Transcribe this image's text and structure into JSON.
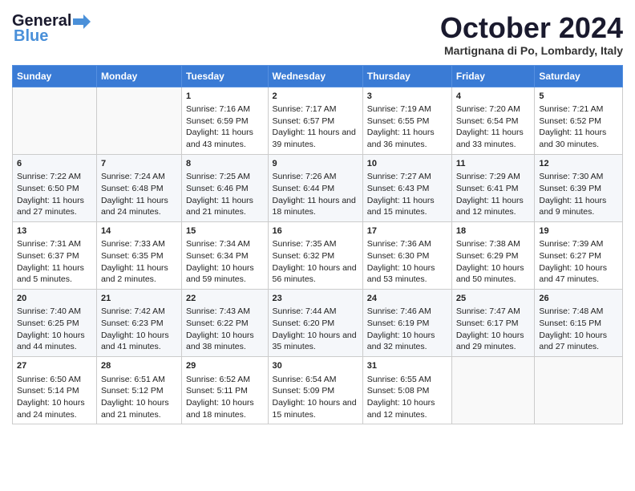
{
  "header": {
    "logo_general": "General",
    "logo_blue": "Blue",
    "title": "October 2024",
    "location": "Martignana di Po, Lombardy, Italy"
  },
  "days_of_week": [
    "Sunday",
    "Monday",
    "Tuesday",
    "Wednesday",
    "Thursday",
    "Friday",
    "Saturday"
  ],
  "weeks": [
    [
      {
        "day": "",
        "content": ""
      },
      {
        "day": "",
        "content": ""
      },
      {
        "day": "1",
        "content": "Sunrise: 7:16 AM\nSunset: 6:59 PM\nDaylight: 11 hours and 43 minutes."
      },
      {
        "day": "2",
        "content": "Sunrise: 7:17 AM\nSunset: 6:57 PM\nDaylight: 11 hours and 39 minutes."
      },
      {
        "day": "3",
        "content": "Sunrise: 7:19 AM\nSunset: 6:55 PM\nDaylight: 11 hours and 36 minutes."
      },
      {
        "day": "4",
        "content": "Sunrise: 7:20 AM\nSunset: 6:54 PM\nDaylight: 11 hours and 33 minutes."
      },
      {
        "day": "5",
        "content": "Sunrise: 7:21 AM\nSunset: 6:52 PM\nDaylight: 11 hours and 30 minutes."
      }
    ],
    [
      {
        "day": "6",
        "content": "Sunrise: 7:22 AM\nSunset: 6:50 PM\nDaylight: 11 hours and 27 minutes."
      },
      {
        "day": "7",
        "content": "Sunrise: 7:24 AM\nSunset: 6:48 PM\nDaylight: 11 hours and 24 minutes."
      },
      {
        "day": "8",
        "content": "Sunrise: 7:25 AM\nSunset: 6:46 PM\nDaylight: 11 hours and 21 minutes."
      },
      {
        "day": "9",
        "content": "Sunrise: 7:26 AM\nSunset: 6:44 PM\nDaylight: 11 hours and 18 minutes."
      },
      {
        "day": "10",
        "content": "Sunrise: 7:27 AM\nSunset: 6:43 PM\nDaylight: 11 hours and 15 minutes."
      },
      {
        "day": "11",
        "content": "Sunrise: 7:29 AM\nSunset: 6:41 PM\nDaylight: 11 hours and 12 minutes."
      },
      {
        "day": "12",
        "content": "Sunrise: 7:30 AM\nSunset: 6:39 PM\nDaylight: 11 hours and 9 minutes."
      }
    ],
    [
      {
        "day": "13",
        "content": "Sunrise: 7:31 AM\nSunset: 6:37 PM\nDaylight: 11 hours and 5 minutes."
      },
      {
        "day": "14",
        "content": "Sunrise: 7:33 AM\nSunset: 6:35 PM\nDaylight: 11 hours and 2 minutes."
      },
      {
        "day": "15",
        "content": "Sunrise: 7:34 AM\nSunset: 6:34 PM\nDaylight: 10 hours and 59 minutes."
      },
      {
        "day": "16",
        "content": "Sunrise: 7:35 AM\nSunset: 6:32 PM\nDaylight: 10 hours and 56 minutes."
      },
      {
        "day": "17",
        "content": "Sunrise: 7:36 AM\nSunset: 6:30 PM\nDaylight: 10 hours and 53 minutes."
      },
      {
        "day": "18",
        "content": "Sunrise: 7:38 AM\nSunset: 6:29 PM\nDaylight: 10 hours and 50 minutes."
      },
      {
        "day": "19",
        "content": "Sunrise: 7:39 AM\nSunset: 6:27 PM\nDaylight: 10 hours and 47 minutes."
      }
    ],
    [
      {
        "day": "20",
        "content": "Sunrise: 7:40 AM\nSunset: 6:25 PM\nDaylight: 10 hours and 44 minutes."
      },
      {
        "day": "21",
        "content": "Sunrise: 7:42 AM\nSunset: 6:23 PM\nDaylight: 10 hours and 41 minutes."
      },
      {
        "day": "22",
        "content": "Sunrise: 7:43 AM\nSunset: 6:22 PM\nDaylight: 10 hours and 38 minutes."
      },
      {
        "day": "23",
        "content": "Sunrise: 7:44 AM\nSunset: 6:20 PM\nDaylight: 10 hours and 35 minutes."
      },
      {
        "day": "24",
        "content": "Sunrise: 7:46 AM\nSunset: 6:19 PM\nDaylight: 10 hours and 32 minutes."
      },
      {
        "day": "25",
        "content": "Sunrise: 7:47 AM\nSunset: 6:17 PM\nDaylight: 10 hours and 29 minutes."
      },
      {
        "day": "26",
        "content": "Sunrise: 7:48 AM\nSunset: 6:15 PM\nDaylight: 10 hours and 27 minutes."
      }
    ],
    [
      {
        "day": "27",
        "content": "Sunrise: 6:50 AM\nSunset: 5:14 PM\nDaylight: 10 hours and 24 minutes."
      },
      {
        "day": "28",
        "content": "Sunrise: 6:51 AM\nSunset: 5:12 PM\nDaylight: 10 hours and 21 minutes."
      },
      {
        "day": "29",
        "content": "Sunrise: 6:52 AM\nSunset: 5:11 PM\nDaylight: 10 hours and 18 minutes."
      },
      {
        "day": "30",
        "content": "Sunrise: 6:54 AM\nSunset: 5:09 PM\nDaylight: 10 hours and 15 minutes."
      },
      {
        "day": "31",
        "content": "Sunrise: 6:55 AM\nSunset: 5:08 PM\nDaylight: 10 hours and 12 minutes."
      },
      {
        "day": "",
        "content": ""
      },
      {
        "day": "",
        "content": ""
      }
    ]
  ]
}
